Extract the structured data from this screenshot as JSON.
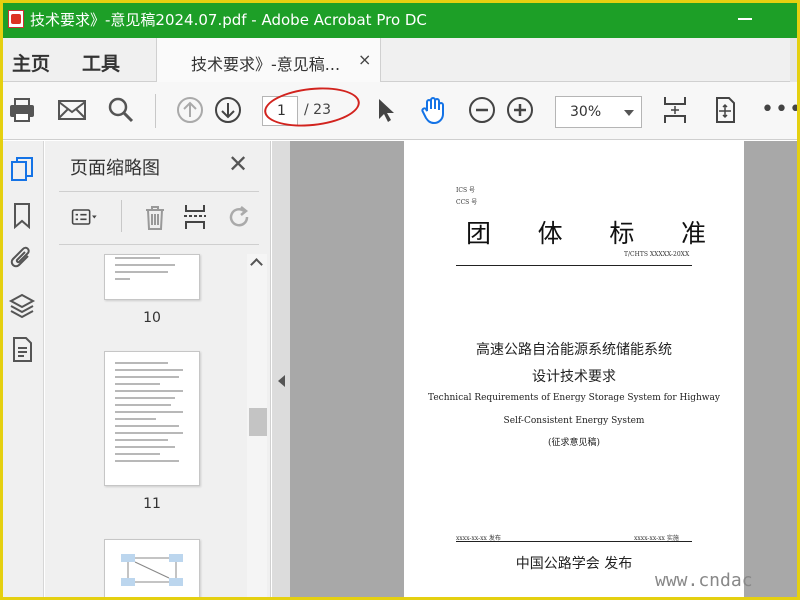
{
  "window": {
    "title": "技术要求》-意见稿2024.07.pdf - Adobe Acrobat Pro DC",
    "title_bar_color": "#1d9f27"
  },
  "tabs": {
    "home": "主页",
    "tools": "工具",
    "document": "技术要求》-意见稿...",
    "close_glyph": "×"
  },
  "toolbar": {
    "icons": [
      "print-icon",
      "email-icon",
      "search-icon",
      "page-up-icon",
      "page-down-icon",
      "select-cursor-icon",
      "hand-icon",
      "zoom-out-icon",
      "zoom-in-icon",
      "fit-page-icon",
      "rotate-page-icon",
      "more-icon"
    ],
    "page_current": "1",
    "page_total": "/ 23",
    "zoom": "30%",
    "more": "•••",
    "annotation_color": "#d2231e"
  },
  "rail": {
    "icons": [
      "pages-icon",
      "bookmark-icon",
      "attachment-icon",
      "layers-icon",
      "content-icon"
    ]
  },
  "thumbnail_panel": {
    "title": "页面缩略图",
    "close_glyph": "✕",
    "thumbnails": [
      {
        "label": "10"
      },
      {
        "label": "11"
      },
      {
        "label": ""
      }
    ]
  },
  "document": {
    "ics": "ICS 号",
    "ccs": "CCS 号",
    "heading_chars": [
      "团",
      "体",
      "标",
      "准"
    ],
    "standard_no": "T/CHTS XXXXX-20XX",
    "title_zh_line1": "高速公路自洽能源系统储能系统",
    "title_zh_line2": "设计技术要求",
    "title_en_line1": "Technical Requirements of Energy Storage System for Highway",
    "title_en_line2": "Self-Consistent Energy System",
    "status": "(征求意见稿)",
    "release_date": "xxxx-xx-xx 发布",
    "effective_date": "xxxx-xx-xx 实施",
    "publisher": "中国公路学会  发布"
  },
  "watermark": "www.cndac"
}
